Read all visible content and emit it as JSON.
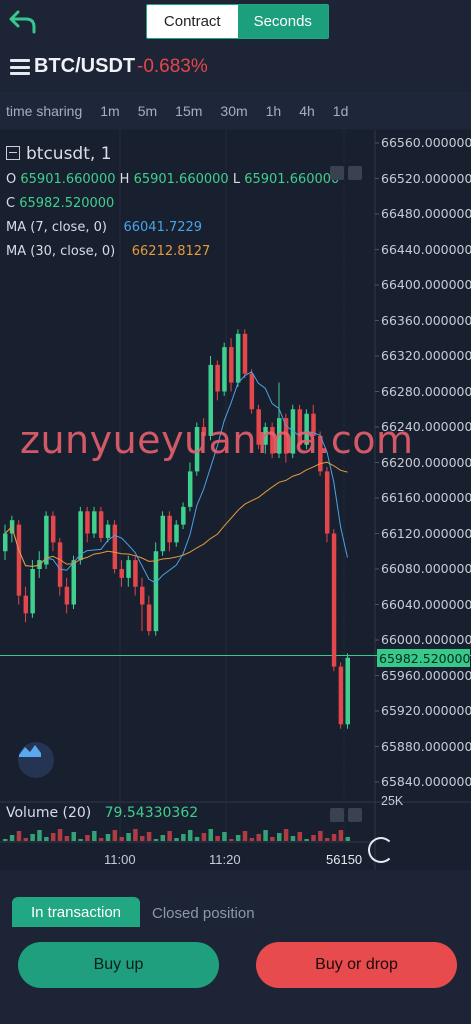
{
  "header": {
    "tabs": [
      {
        "label": "Contract",
        "active": false
      },
      {
        "label": "Seconds",
        "active": true
      }
    ],
    "back_icon": "back-arrow-icon"
  },
  "pair": {
    "symbol": "BTC/USDT",
    "change": "-0.683%",
    "change_color": "#e2474b"
  },
  "timeframes": [
    "time sharing",
    "1m",
    "5m",
    "15m",
    "30m",
    "1h",
    "4h",
    "1d"
  ],
  "legend": {
    "title": "btcusdt, 1",
    "o_label": "O",
    "o_value": "65901.660000",
    "h_label": "H",
    "h_value": "65901.660000",
    "l_label": "L",
    "l_value": "65901.660000",
    "c_label": "C",
    "c_value": "65982.520000",
    "ma7_label": "MA (7, close, 0)",
    "ma7_value": "66041.7229",
    "ma30_label": "MA (30, close, 0)",
    "ma30_value": "66212.8127"
  },
  "watermark": "zunyueyuanma.com",
  "volume": {
    "label": "Volume (20)",
    "value": "79.54330362",
    "max_label": "25K",
    "current": "56150"
  },
  "chart_data": {
    "type": "candlestick",
    "y_ticks": [
      "66560.000000",
      "66520.000000",
      "66480.000000",
      "66440.000000",
      "66400.000000",
      "66360.000000",
      "66320.000000",
      "66280.000000",
      "66240.000000",
      "66200.000000",
      "66160.000000",
      "66120.000000",
      "66080.000000",
      "66040.000000",
      "66000.000000",
      "65960.000000",
      "65920.000000",
      "65880.000000",
      "65840.000000"
    ],
    "ylim": [
      65820,
      66580
    ],
    "current_price": "65982.520000",
    "x_ticks": [
      "11:00",
      "11:20"
    ],
    "up_color": "#3fcf8e",
    "down_color": "#e2474b",
    "candles": [
      {
        "o": 66100,
        "c": 66120,
        "h": 66130,
        "l": 66090
      },
      {
        "o": 66120,
        "c": 66135,
        "h": 66140,
        "l": 66110
      },
      {
        "o": 66130,
        "c": 66050,
        "h": 66135,
        "l": 66040
      },
      {
        "o": 66050,
        "c": 66030,
        "h": 66060,
        "l": 66020
      },
      {
        "o": 66030,
        "c": 66080,
        "h": 66090,
        "l": 66025
      },
      {
        "o": 66080,
        "c": 66090,
        "h": 66100,
        "l": 66070
      },
      {
        "o": 66085,
        "c": 66140,
        "h": 66145,
        "l": 66080
      },
      {
        "o": 66140,
        "c": 66110,
        "h": 66145,
        "l": 66100
      },
      {
        "o": 66110,
        "c": 66060,
        "h": 66115,
        "l": 66050
      },
      {
        "o": 66060,
        "c": 66040,
        "h": 66070,
        "l": 66030
      },
      {
        "o": 66040,
        "c": 66090,
        "h": 66095,
        "l": 66035
      },
      {
        "o": 66090,
        "c": 66145,
        "h": 66150,
        "l": 66085
      },
      {
        "o": 66145,
        "c": 66120,
        "h": 66150,
        "l": 66110
      },
      {
        "o": 66120,
        "c": 66145,
        "h": 66150,
        "l": 66115
      },
      {
        "o": 66145,
        "c": 66115,
        "h": 66150,
        "l": 66110
      },
      {
        "o": 66115,
        "c": 66130,
        "h": 66135,
        "l": 66110
      },
      {
        "o": 66130,
        "c": 66080,
        "h": 66135,
        "l": 66075
      },
      {
        "o": 66080,
        "c": 66070,
        "h": 66090,
        "l": 66060
      },
      {
        "o": 66070,
        "c": 66090,
        "h": 66095,
        "l": 66060
      },
      {
        "o": 66090,
        "c": 66060,
        "h": 66095,
        "l": 66050
      },
      {
        "o": 66060,
        "c": 66040,
        "h": 66070,
        "l": 66010
      },
      {
        "o": 66040,
        "c": 66010,
        "h": 66050,
        "l": 66005
      },
      {
        "o": 66010,
        "c": 66100,
        "h": 66110,
        "l": 66005
      },
      {
        "o": 66100,
        "c": 66140,
        "h": 66145,
        "l": 66095
      },
      {
        "o": 66140,
        "c": 66110,
        "h": 66145,
        "l": 66100
      },
      {
        "o": 66110,
        "c": 66130,
        "h": 66135,
        "l": 66105
      },
      {
        "o": 66130,
        "c": 66150,
        "h": 66155,
        "l": 66125
      },
      {
        "o": 66150,
        "c": 66190,
        "h": 66200,
        "l": 66145
      },
      {
        "o": 66190,
        "c": 66240,
        "h": 66245,
        "l": 66185
      },
      {
        "o": 66240,
        "c": 66230,
        "h": 66250,
        "l": 66220
      },
      {
        "o": 66230,
        "c": 66310,
        "h": 66320,
        "l": 66225
      },
      {
        "o": 66310,
        "c": 66280,
        "h": 66315,
        "l": 66270
      },
      {
        "o": 66280,
        "c": 66330,
        "h": 66335,
        "l": 66275
      },
      {
        "o": 66330,
        "c": 66290,
        "h": 66340,
        "l": 66280
      },
      {
        "o": 66290,
        "c": 66345,
        "h": 66350,
        "l": 66285
      },
      {
        "o": 66345,
        "c": 66300,
        "h": 66350,
        "l": 66295
      },
      {
        "o": 66300,
        "c": 66260,
        "h": 66305,
        "l": 66255
      },
      {
        "o": 66260,
        "c": 66220,
        "h": 66265,
        "l": 66215
      },
      {
        "o": 66220,
        "c": 66240,
        "h": 66245,
        "l": 66210
      },
      {
        "o": 66240,
        "c": 66210,
        "h": 66245,
        "l": 66205
      },
      {
        "o": 66210,
        "c": 66250,
        "h": 66290,
        "l": 66205
      },
      {
        "o": 66250,
        "c": 66210,
        "h": 66255,
        "l": 66200
      },
      {
        "o": 66210,
        "c": 66260,
        "h": 66265,
        "l": 66205
      },
      {
        "o": 66260,
        "c": 66220,
        "h": 66265,
        "l": 66215
      },
      {
        "o": 66220,
        "c": 66255,
        "h": 66260,
        "l": 66215
      },
      {
        "o": 66255,
        "c": 66230,
        "h": 66265,
        "l": 66225
      },
      {
        "o": 66230,
        "c": 66190,
        "h": 66235,
        "l": 66185
      },
      {
        "o": 66190,
        "c": 66120,
        "h": 66195,
        "l": 66110
      },
      {
        "o": 66120,
        "c": 65970,
        "h": 66125,
        "l": 65965
      },
      {
        "o": 65970,
        "c": 65905,
        "h": 65975,
        "l": 65900
      },
      {
        "o": 65905,
        "c": 65980,
        "h": 65985,
        "l": 65900
      }
    ]
  },
  "bottom": {
    "tab_active": "In transaction",
    "tab_inactive": "Closed position",
    "buy_up": "Buy up",
    "buy_drop": "Buy or drop",
    "buy_up_color": "#1f9f7d",
    "buy_drop_color": "#e84b4e"
  }
}
